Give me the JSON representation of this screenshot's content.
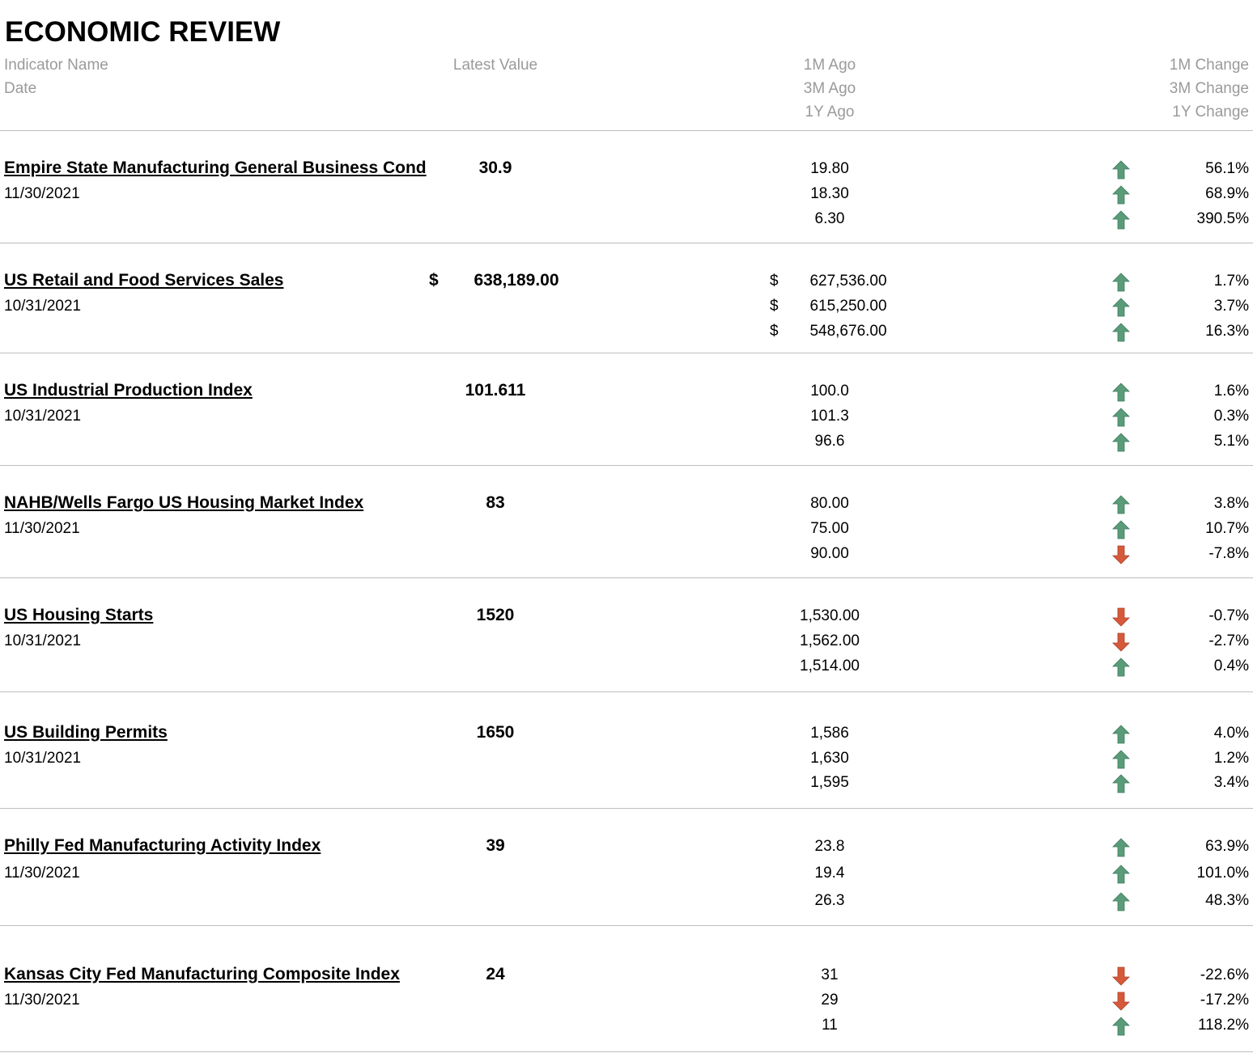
{
  "title": "ECONOMIC REVIEW",
  "colors": {
    "up": "#5a9c7a",
    "down": "#d65a3a",
    "header_text": "#9a9a9a"
  },
  "headers": {
    "indicator_name": "Indicator Name",
    "date": "Date",
    "latest_value": "Latest Value",
    "m1_ago": "1M Ago",
    "m3_ago": "3M Ago",
    "y1_ago": "1Y Ago",
    "m1_change": "1M Change",
    "m3_change": "3M Change",
    "y1_change": "1Y Change"
  },
  "indicators": [
    {
      "name": "Empire State Manufacturing General Business Cond",
      "date": "11/30/2021",
      "latest": "30.9",
      "latest_currency": "",
      "ago": [
        "19.80",
        "18.30",
        "6.30"
      ],
      "ago_currency": "",
      "changes": [
        "56.1%",
        "68.9%",
        "390.5%"
      ],
      "directions": [
        "up-arrow-icon",
        "up-arrow-icon",
        "up-arrow-icon"
      ]
    },
    {
      "name": "US Retail and Food Services Sales",
      "date": "10/31/2021",
      "latest": "638,189.00",
      "latest_currency": "$",
      "ago": [
        "627,536.00",
        "615,250.00",
        "548,676.00"
      ],
      "ago_currency": "$",
      "changes": [
        "1.7%",
        "3.7%",
        "16.3%"
      ],
      "directions": [
        "up-arrow-icon",
        "up-arrow-icon",
        "up-arrow-icon"
      ]
    },
    {
      "name": "US Industrial Production Index",
      "date": "10/31/2021",
      "latest": "101.611",
      "latest_currency": "",
      "ago": [
        "100.0",
        "101.3",
        "96.6"
      ],
      "ago_currency": "",
      "changes": [
        "1.6%",
        "0.3%",
        "5.1%"
      ],
      "directions": [
        "up-arrow-icon",
        "up-arrow-icon",
        "up-arrow-icon"
      ]
    },
    {
      "name": "NAHB/Wells Fargo US Housing Market Index",
      "date": "11/30/2021",
      "latest": "83",
      "latest_currency": "",
      "ago": [
        "80.00",
        "75.00",
        "90.00"
      ],
      "ago_currency": "",
      "changes": [
        "3.8%",
        "10.7%",
        "-7.8%"
      ],
      "directions": [
        "up-arrow-icon",
        "up-arrow-icon",
        "down-arrow-icon"
      ]
    },
    {
      "name": "US Housing Starts",
      "date": "10/31/2021",
      "latest": "1520",
      "latest_currency": "",
      "ago": [
        "1,530.00",
        "1,562.00",
        "1,514.00"
      ],
      "ago_currency": "",
      "changes": [
        "-0.7%",
        "-2.7%",
        "0.4%"
      ],
      "directions": [
        "down-arrow-icon",
        "down-arrow-icon",
        "up-arrow-icon"
      ]
    },
    {
      "name": "US Building Permits",
      "date": "10/31/2021",
      "latest": "1650",
      "latest_currency": "",
      "ago": [
        "1,586",
        "1,630",
        "1,595"
      ],
      "ago_currency": "",
      "changes": [
        "4.0%",
        "1.2%",
        "3.4%"
      ],
      "directions": [
        "up-arrow-icon",
        "up-arrow-icon",
        "up-arrow-icon"
      ]
    },
    {
      "name": "Philly Fed Manufacturing Activity Index",
      "date": "11/30/2021",
      "latest": "39",
      "latest_currency": "",
      "ago": [
        "23.8",
        "19.4",
        "26.3"
      ],
      "ago_currency": "",
      "changes": [
        "63.9%",
        "101.0%",
        "48.3%"
      ],
      "directions": [
        "up-arrow-icon",
        "up-arrow-icon",
        "up-arrow-icon"
      ]
    },
    {
      "name": "Kansas City Fed Manufacturing Composite Index",
      "date": "11/30/2021",
      "latest": "24",
      "latest_currency": "",
      "ago": [
        "31",
        "29",
        "11"
      ],
      "ago_currency": "",
      "changes": [
        "-22.6%",
        "-17.2%",
        "118.2%"
      ],
      "directions": [
        "down-arrow-icon",
        "down-arrow-icon",
        "up-arrow-icon"
      ]
    }
  ]
}
